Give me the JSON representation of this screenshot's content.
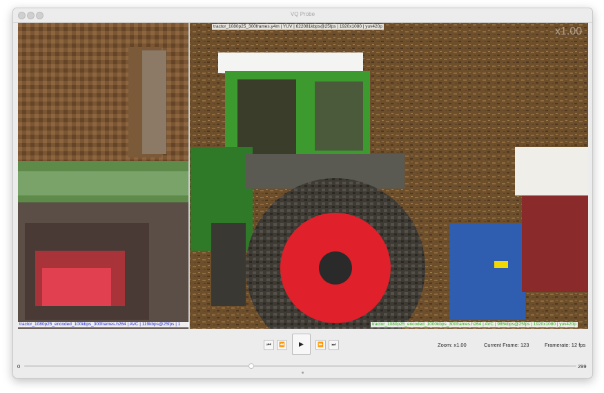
{
  "window": {
    "title": "VQ Probe"
  },
  "video": {
    "top_label": "tractor_1080p25_300frames.y4m | YUV | 622081kbps@25fps | 1920x1080 | yuv420p",
    "zoom_overlay": "x1.00",
    "left_label": "tractor_1080p25_encoded_100kbps_300frames.h264 | AVC | 119kbps@25fps | 1",
    "right_label": "tractor_1080p25_encoded_1000kbps_300frames.h264 | AVC | 985kbps@25fps | 1920x1080 | yuv420p"
  },
  "controls": {
    "buttons": {
      "first": "⏮",
      "prev": "⏪",
      "play": "▶",
      "next": "⏩",
      "last": "⏭"
    },
    "zoom_label": "Zoom:",
    "zoom_value": "x1.00",
    "frame_label": "Current Frame:",
    "frame_value": "123",
    "framerate_label": "Framerate:",
    "framerate_value": "12",
    "framerate_unit": "fps"
  },
  "timeline": {
    "min": "0",
    "max": "299",
    "current": 123,
    "total": 299
  },
  "colors": {
    "left_label_text": "#1b2bd6",
    "right_label_text": "#2aa81a",
    "top_label_text": "#2a2a2a",
    "tire_red": "#e0202a",
    "tractor_green": "#3c9a2e",
    "soil": "#6b4c2a"
  }
}
